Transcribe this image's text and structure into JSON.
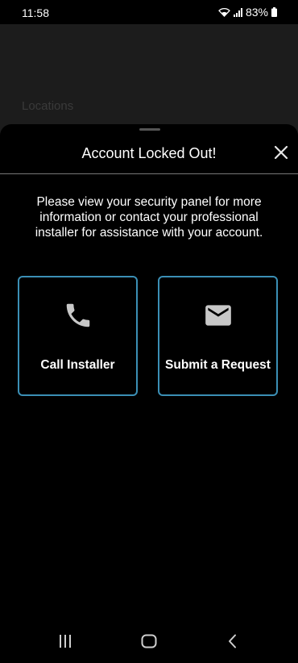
{
  "status_bar": {
    "time": "11:58",
    "battery": "83%",
    "icons": [
      "wifi-icon",
      "signal-icon",
      "battery-icon"
    ]
  },
  "background": {
    "label": "Locations"
  },
  "sheet": {
    "title": "Account Locked Out!",
    "message": "Please view your security panel for more information or contact your professional installer for assistance with your account.",
    "close_icon": "close-icon"
  },
  "actions": [
    {
      "label": "Call Installer",
      "icon": "phone-icon"
    },
    {
      "label": "Submit a Request",
      "icon": "mail-icon"
    }
  ],
  "nav_bar": {
    "buttons": [
      "recent-apps-icon",
      "home-icon",
      "back-icon"
    ]
  },
  "colors": {
    "accent_border": "#3b8fb5",
    "icon_gray": "#c8c8c8",
    "background": "#000000"
  }
}
